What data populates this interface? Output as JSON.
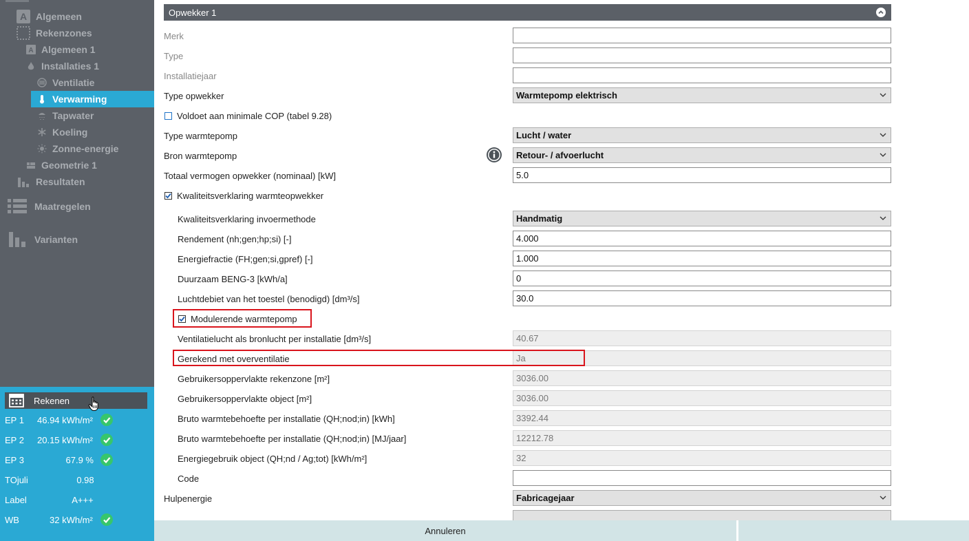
{
  "sidebar": {
    "items": [
      {
        "label": "Algemeen",
        "icon": "letter-a-icon"
      },
      {
        "label": "Rekenzones",
        "icon": "dotted-square-icon"
      },
      {
        "label": "Algemeen 1",
        "icon": "letter-a-icon"
      },
      {
        "label": "Installaties 1",
        "icon": "flame-icon"
      },
      {
        "label": "Ventilatie",
        "icon": "fan-icon"
      },
      {
        "label": "Verwarming",
        "icon": "thermometer-icon"
      },
      {
        "label": "Tapwater",
        "icon": "shower-icon"
      },
      {
        "label": "Koeling",
        "icon": "snowflake-icon"
      },
      {
        "label": "Zonne-energie",
        "icon": "sun-icon"
      },
      {
        "label": "Geometrie 1",
        "icon": "floorplan-icon"
      },
      {
        "label": "Resultaten",
        "icon": "bar-chart-icon"
      },
      {
        "label": "Maatregelen",
        "icon": "list-icon"
      },
      {
        "label": "Varianten",
        "icon": "bar-chart-icon"
      }
    ],
    "active_color": "#2aa9d4"
  },
  "rekenen": {
    "button_label": "Rekenen",
    "rows": [
      {
        "label": "EP 1",
        "value": "46.94 kWh/m²",
        "ok": true
      },
      {
        "label": "EP 2",
        "value": "20.15 kWh/m²",
        "ok": true
      },
      {
        "label": "EP 3",
        "value": "67.9 %",
        "ok": true
      },
      {
        "label": "TOjuli",
        "value": "0.98",
        "ok": false
      },
      {
        "label": "Label",
        "value": "A+++",
        "ok": false
      },
      {
        "label": "WB",
        "value": "32 kWh/m²",
        "ok": true
      }
    ]
  },
  "panel": {
    "title": "Opwekker 1",
    "fields": {
      "merk": {
        "label": "Merk",
        "value": ""
      },
      "type": {
        "label": "Type",
        "value": ""
      },
      "installatiejaar": {
        "label": "Installatiejaar",
        "value": ""
      },
      "type_opwekker": {
        "label": "Type opwekker",
        "value": "Warmtepomp elektrisch"
      },
      "min_cop": {
        "label": "Voldoet aan minimale COP (tabel 9.28)",
        "checked": false
      },
      "type_warmtepomp": {
        "label": "Type warmtepomp",
        "value": "Lucht / water"
      },
      "bron_warmtepomp": {
        "label": "Bron warmtepomp",
        "value": "Retour- / afvoerlucht"
      },
      "totaal_vermogen": {
        "label": "Totaal vermogen opwekker (nominaal) [kW]",
        "value": "5.0"
      },
      "kwaliteitsverklaring": {
        "label": "Kwaliteitsverklaring warmteopwekker",
        "checked": true
      },
      "invoermethode": {
        "label": "Kwaliteitsverklaring invoermethode",
        "value": "Handmatig"
      },
      "rendement": {
        "label": "Rendement (nh;gen;hp;si) [-]",
        "value": "4.000"
      },
      "energiefractie": {
        "label": "Energiefractie (FH;gen;si,gpref) [-]",
        "value": "1.000"
      },
      "duurzaam": {
        "label": "Duurzaam BENG-3 [kWh/a]",
        "value": "0"
      },
      "luchtdebiet": {
        "label": "Luchtdebiet van het toestel (benodigd) [dm³/s]",
        "value": "30.0"
      },
      "modulerend": {
        "label": "Modulerende warmtepomp",
        "checked": true
      },
      "ventilatielucht": {
        "label": "Ventilatielucht als bronlucht per installatie [dm³/s]",
        "value": "40.67"
      },
      "overventilatie": {
        "label": "Gerekend met overventilatie",
        "value": "Ja"
      },
      "opp_rekenzone": {
        "label": "Gebruikersoppervlakte rekenzone [m²]",
        "value": "3036.00"
      },
      "opp_object": {
        "label": "Gebruikersoppervlakte object [m²]",
        "value": "3036.00"
      },
      "bruto_kwh": {
        "label": "Bruto warmtebehoefte per installatie (QH;nod;in) [kWh]",
        "value": "3392.44"
      },
      "bruto_mj": {
        "label": "Bruto warmtebehoefte per installatie (QH;nod;in) [MJ/jaar]",
        "value": "12212.78"
      },
      "energiegebruik": {
        "label": "Energiegebruik object (QH;nd / Ag;tot) [kWh/m²]",
        "value": "32"
      },
      "code": {
        "label": "Code",
        "value": ""
      },
      "hulpenergie": {
        "label": "Hulpenergie",
        "value": "Fabricagejaar"
      }
    }
  },
  "footer": {
    "cancel_label": "Annuleren"
  }
}
